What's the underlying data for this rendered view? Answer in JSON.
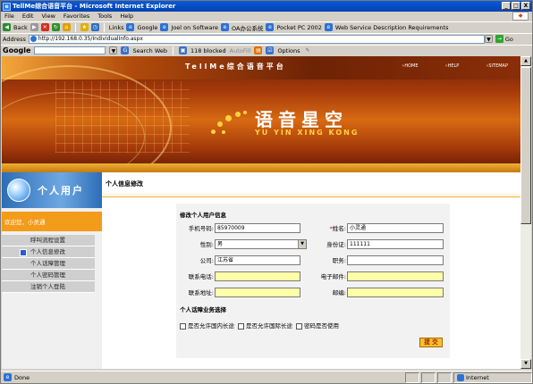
{
  "window": {
    "title": "TellMe综合语音平台 - Microsoft Internet Explorer",
    "min": "_",
    "max": "□",
    "close": "X"
  },
  "menu": [
    "File",
    "Edit",
    "View",
    "Favorites",
    "Tools",
    "Help"
  ],
  "toolbar": {
    "back": "Back",
    "links_label": "Links",
    "links": [
      "Google",
      "Joel on Software",
      "OA办公系统",
      "Pocket PC 2002",
      "Web Service Description Requirements"
    ]
  },
  "address": {
    "label": "Address",
    "url": "http://192.168.0.35/IndividualInfo.aspx",
    "go": "Go"
  },
  "googlebar": {
    "logo": "Google",
    "search_web": "Search Web",
    "blocked": "118 blocked",
    "autofill": "AutoFill",
    "options": "Options"
  },
  "banner": {
    "site_title": "TellMe综合语音平台",
    "nav": [
      "HOME",
      "HELP",
      "SITEMAP"
    ],
    "brand_zh": "语音星空",
    "brand_en": "YU YIN XING KONG"
  },
  "sidebar": {
    "header": "个人用户",
    "welcome": "欢迎您，小灵通",
    "items": [
      "呼叫流程设置",
      "个人信息修改",
      "个人话障管理",
      "个人密码管理",
      "注销个人登陆"
    ],
    "active_index": 1
  },
  "breadcrumb": "个人信息修改",
  "form": {
    "title": "修改个人用户信息",
    "phone_label": "手机号码:",
    "phone_value": "85970009",
    "name_label": "姓名:",
    "name_value": "小灵通",
    "gender_label": "性别:",
    "gender_value": "男",
    "id_label": "身份证:",
    "id_value": "111111",
    "company_label": "公司:",
    "company_value": "江苏省",
    "position_label": "职务:",
    "position_value": "",
    "contact_phone_label": "联系电话:",
    "contact_phone_value": "",
    "email_label": "电子邮件:",
    "email_value": "",
    "address_label": "联系地址:",
    "address_value": "",
    "zip_label": "邮编:",
    "zip_value": "",
    "services_title": "个人话障业务选择",
    "check_domestic": "是否允许国内长途",
    "check_international": "是否允许国际长途",
    "check_password": "密码是否使用",
    "submit": "提 交",
    "required_mark": "*"
  },
  "status": {
    "text": "Done",
    "zone": "Internet"
  },
  "colors": {
    "accent_orange": "#f39b1a",
    "sidebar_blue": "#2c6db8",
    "submit_yellow": "#f8c02e"
  }
}
